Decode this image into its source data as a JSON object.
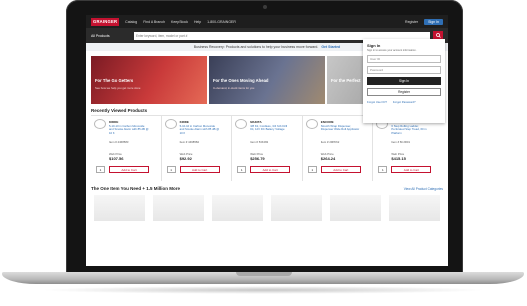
{
  "header": {
    "logo": "GRAINGER",
    "nav": [
      "Catalog",
      "Find A Branch",
      "KeepStock",
      "Help",
      "1-800-GRAINGER"
    ],
    "register": "Register",
    "sign_in": "Sign In"
  },
  "search": {
    "category": "All Products",
    "placeholder": "Enter keyword, item, model or part #"
  },
  "banner": {
    "text": "Business Recovery: Products and solutions to help your business move forward.",
    "link": "Get Started"
  },
  "hero": [
    {
      "title": "For The Go Getters",
      "sub": "See how we help you get more done"
    },
    {
      "title": "For the Ones Moving Ahead",
      "sub": "In-demand, in-stock items for you"
    },
    {
      "title": "For the Perfect",
      "sub": ""
    }
  ],
  "recent": {
    "title": "Recently Viewed Products",
    "items": [
      {
        "brand": "KIDDE",
        "name": "5-10-10 in Carbon Monoxide and Smoke Alarm with 85 dB @ 10 ft",
        "item": "Item # 4468583",
        "web_price_label": "Web Price",
        "price": "$107.56",
        "unit": "/ each",
        "qty": "1",
        "add": "Add to Cart"
      },
      {
        "brand": "KIDDE",
        "name": "5-10-10 in Carbon Monoxide and Smoke Alarm with 85 dB @ 10 ft",
        "item": "Item # 4468582",
        "web_price_label": "Web Price",
        "price": "$92.92",
        "unit": "/ each",
        "qty": "1",
        "add": "Add to Cart"
      },
      {
        "brand": "MAKITA",
        "name": "3/8 Kit, Cordless, 3/4 ft-lb Drill Kit, 12V DC Battery Voltage",
        "item": "Item # 53KJ82",
        "web_price_label": "Web Price",
        "price": "$256.79",
        "unit": "/ each",
        "qty": "1",
        "add": "Add to Cart"
      },
      {
        "brand": "ENCORE",
        "name": "Stretch Wrap Dispenser, Dispenser Wide Roll Applicator",
        "item": "Item # 29PK62",
        "web_price_label": "Web Price",
        "price": "$264.24",
        "unit": "/ each",
        "qty": "1",
        "add": "Add to Cart"
      },
      {
        "brand": "COTTERMAN",
        "name": "6 Step Rolling Ladder, Perforated Step Tread, 60 in Platform",
        "item": "Item # 8CJR01",
        "web_price_label": "Web Price",
        "price": "$415.15",
        "unit": "/ each",
        "qty": "1",
        "add": "Add to Cart"
      }
    ]
  },
  "more": {
    "title": "The One Item You Need + 1.5 Million More",
    "view_all": "View All Product Categories"
  },
  "signin": {
    "title": "Sign In",
    "subtitle": "Sign in to access your account information.",
    "user_placeholder": "User ID",
    "pass_placeholder": "Password",
    "sign_in": "Sign In",
    "register": "Register",
    "forgot_user": "Forgot User ID?",
    "forgot_pass": "Forgot Password?"
  }
}
